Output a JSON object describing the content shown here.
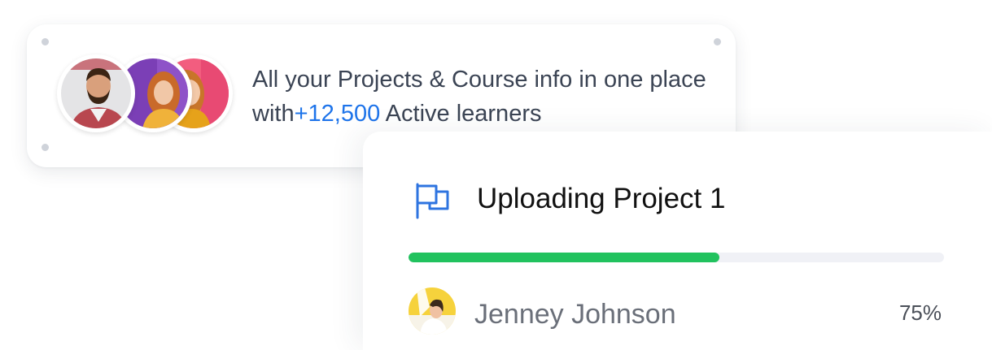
{
  "promo_card": {
    "text_before": "All your Projects & Course info in one place with",
    "highlight": "+12,500",
    "text_after": " Active learners",
    "highlight_color": "#1e74ea",
    "avatars": [
      "man-avatar",
      "woman-purple-avatar",
      "woman-pink-avatar"
    ]
  },
  "upload_card": {
    "icon": "flag-icon",
    "title": "Uploading Project 1",
    "progress_fraction": 0.58,
    "progress_color": "#21c25e",
    "user": {
      "name": "Jenney Johnson",
      "avatar": "user-avatar"
    },
    "percent_label": "75%"
  }
}
